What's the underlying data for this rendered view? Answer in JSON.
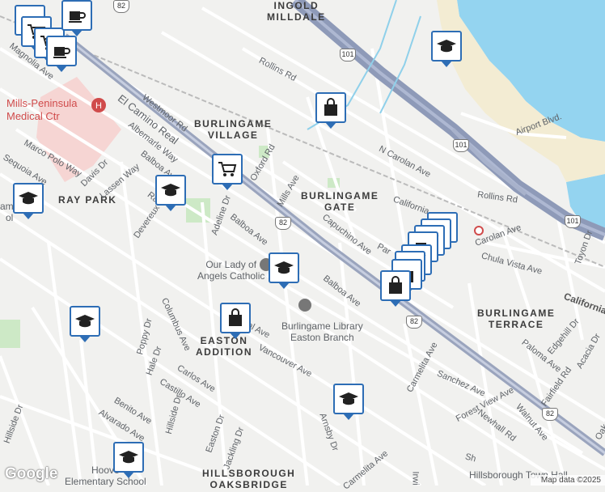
{
  "areas": [
    {
      "key": "millsdale",
      "text": "INGOLD\nMILLDALE"
    },
    {
      "key": "burlingame_village",
      "text": "BURLINGAME\nVILLAGE"
    },
    {
      "key": "ray_park",
      "text": "RAY PARK"
    },
    {
      "key": "burlingame_gate",
      "text": "BURLINGAME\nGATE"
    },
    {
      "key": "easton_addition",
      "text": "EASTON\nADDITION"
    },
    {
      "key": "burlingame_terrace",
      "text": "BURLINGAME\nTERRACE"
    },
    {
      "key": "hillsborough_oaksbrige",
      "text": "HILLSBOROUGH\nOAKSBRIDGE"
    }
  ],
  "streets": [
    {
      "key": "rollins_rd",
      "text": "Rollins Rd"
    },
    {
      "key": "rollins_rd_2",
      "text": "Rollins Rd"
    },
    {
      "key": "airport_blvd",
      "text": "Airport Blvd."
    },
    {
      "key": "el_camino",
      "text": "El Camino Real"
    },
    {
      "key": "magnolia",
      "text": "Magnolia Ave"
    },
    {
      "key": "westmoor",
      "text": "Westmoor Rd"
    },
    {
      "key": "albemarle",
      "text": "Albemarle Way"
    },
    {
      "key": "balboa_top",
      "text": "Balboa Av"
    },
    {
      "key": "oxford",
      "text": "Oxford Rd"
    },
    {
      "key": "marco_polo",
      "text": "Marco Polo Way"
    },
    {
      "key": "davis",
      "text": "Davis Dr"
    },
    {
      "key": "lassen",
      "text": "Lassen Way"
    },
    {
      "key": "sequoia",
      "text": "Sequoia Ave"
    },
    {
      "key": "devereux",
      "text": "Devereux Dr"
    },
    {
      "key": "mills_ave",
      "text": "Mills Ave"
    },
    {
      "key": "n_carolan",
      "text": "N Carolan Ave"
    },
    {
      "key": "california",
      "text": "California"
    },
    {
      "key": "carolan",
      "text": "Carolan Ave"
    },
    {
      "key": "capuchino",
      "text": "Capuchino Ave"
    },
    {
      "key": "adeline",
      "text": "Adeline Dr"
    },
    {
      "key": "balboa_ave",
      "text": "Balboa Ave"
    },
    {
      "key": "balboa_ave2",
      "text": "Balboa Ave"
    },
    {
      "key": "chula_vista",
      "text": "Chula Vista Ave"
    },
    {
      "key": "california_dr",
      "text": "California"
    },
    {
      "key": "toyon",
      "text": "Toyon Dr"
    },
    {
      "key": "edgehill",
      "text": "Edgehill Dr"
    },
    {
      "key": "paloma",
      "text": "Paloma Ave"
    },
    {
      "key": "acacia",
      "text": "Acacia Dr"
    },
    {
      "key": "fairfield",
      "text": "Fairfield Rd"
    },
    {
      "key": "columbus",
      "text": "Columbus Ave"
    },
    {
      "key": "poppy",
      "text": "Poppy Dr"
    },
    {
      "key": "hale",
      "text": "Hale Dr"
    },
    {
      "key": "carlos",
      "text": "Carlos Ave"
    },
    {
      "key": "castillo",
      "text": "Castillo Ave"
    },
    {
      "key": "benito",
      "text": "Benito Ave"
    },
    {
      "key": "alvarado",
      "text": "Alvarado Ave"
    },
    {
      "key": "hillside1",
      "text": "Hillside Dr"
    },
    {
      "key": "hillside2",
      "text": "Hillside Dr"
    },
    {
      "key": "easton_dr",
      "text": "Easton Dr"
    },
    {
      "key": "jackling",
      "text": "Jackling Dr"
    },
    {
      "key": "vancouver",
      "text": "Vancouver Ave"
    },
    {
      "key": "arnsby",
      "text": "Arnsby Dr"
    },
    {
      "key": "carmelita1",
      "text": "Carmelita Ave"
    },
    {
      "key": "carmelita2",
      "text": "Carmelita Ave"
    },
    {
      "key": "sanchez",
      "text": "Sanchez Ave"
    },
    {
      "key": "forest_view",
      "text": "Forest View Ave"
    },
    {
      "key": "newhall",
      "text": "Newhall Rd"
    },
    {
      "key": "walnut",
      "text": "Walnut Ave"
    },
    {
      "key": "shi",
      "text": "Sh"
    },
    {
      "key": "irwin",
      "text": "Irwi"
    },
    {
      "key": "oak",
      "text": "Oak"
    },
    {
      "key": "mal",
      "text": "mal Ave"
    },
    {
      "key": "ra",
      "text": "Ra"
    },
    {
      "key": "par",
      "text": "Par"
    }
  ],
  "pois": [
    {
      "key": "mills_peninsula",
      "text": "Mills-Peninsula\nMedical Ctr"
    },
    {
      "key": "our_lady",
      "text": "Our Lady of\nAngels Catholic"
    },
    {
      "key": "library",
      "text": "Burlingame Library\nEaston Branch"
    },
    {
      "key": "hillsborough_town_hall",
      "text": "Hillsborough Town Hall"
    },
    {
      "key": "hoover",
      "text": "Hoove\nElementary School"
    },
    {
      "key": "ame",
      "text": "ame\nol"
    }
  ],
  "shields": [
    "101",
    "101",
    "101",
    "82",
    "82",
    "82",
    "82"
  ],
  "markers": [
    {
      "icon": "coffee-icon"
    },
    {
      "icon": "grocery-icon"
    },
    {
      "icon": "grocery-icon"
    },
    {
      "icon": "coffee-icon"
    },
    {
      "icon": "school-icon"
    },
    {
      "icon": "shopping-bag-icon"
    },
    {
      "icon": "grocery-icon"
    },
    {
      "icon": "school-icon"
    },
    {
      "icon": "school-icon"
    },
    {
      "icon": "school-icon"
    },
    {
      "icon": "shopping-bag-icon"
    },
    {
      "icon": "school-icon"
    },
    {
      "icon": "school-icon"
    },
    {
      "icon": "school-icon"
    },
    {
      "icon": "grocery-icon"
    },
    {
      "icon": "shopping-bag-icon"
    }
  ],
  "attribution": {
    "google": "Google",
    "map_data": "Map data ©2025",
    "terms": ""
  },
  "colors": {
    "water": "#94d4f0",
    "park": "#cde9c6",
    "hospital": "#f6d5d3",
    "highway": "#8e9ab8",
    "marker": "#2d6db5"
  }
}
